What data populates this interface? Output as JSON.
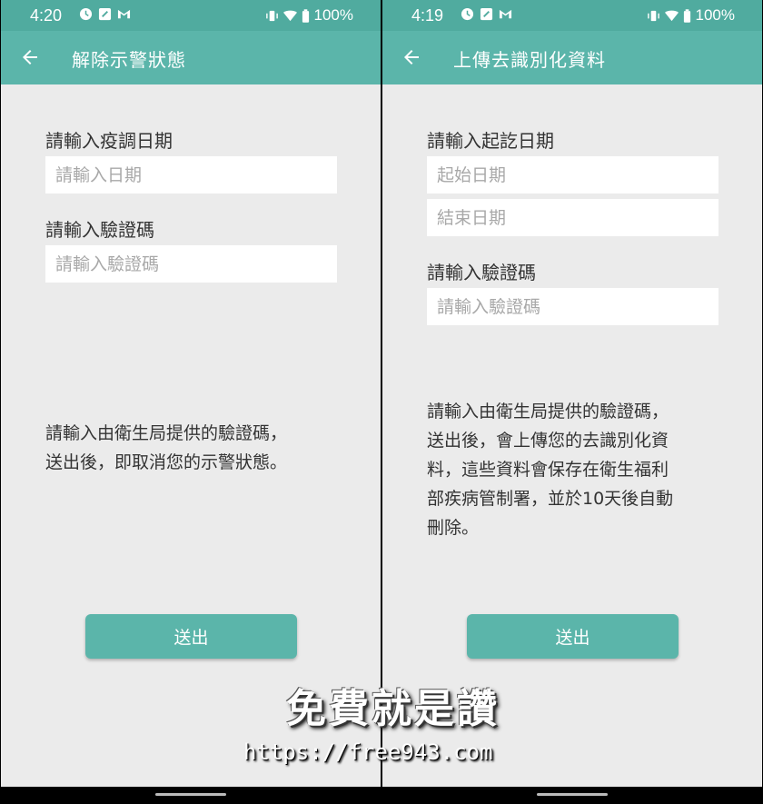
{
  "left": {
    "status": {
      "time": "4:20",
      "battery": "100%"
    },
    "appbar": {
      "title": "解除示警狀態"
    },
    "form": {
      "date_label": "請輸入疫調日期",
      "date_placeholder": "請輸入日期",
      "code_label": "請輸入驗證碼",
      "code_placeholder": "請輸入驗證碼"
    },
    "description": {
      "line1": "請輸入由衛生局提供的驗證碼，",
      "line2": "送出後，即取消您的示警狀態。"
    },
    "submit_label": "送出"
  },
  "right": {
    "status": {
      "time": "4:19",
      "battery": "100%"
    },
    "appbar": {
      "title": "上傳去識別化資料"
    },
    "form": {
      "date_label": "請輸入起訖日期",
      "start_placeholder": "起始日期",
      "end_placeholder": "結束日期",
      "code_label": "請輸入驗證碼",
      "code_placeholder": "請輸入驗證碼"
    },
    "description": {
      "line1": "請輸入由衛生局提供的驗證碼，",
      "line2": "送出後，會上傳您的去識別化資",
      "line3": "料，這些資料會保存在衛生福利",
      "line4": "部疾病管制署，並於10天後自動",
      "line5": "刪除。"
    },
    "submit_label": "送出"
  },
  "watermark": {
    "title": "免費就是讚",
    "url": "https://free943.com"
  },
  "icons": [
    "alarm-icon",
    "edit-icon",
    "gmail-icon",
    "vibrate-icon",
    "wifi-icon",
    "battery-icon",
    "back-arrow-icon"
  ],
  "colors": {
    "statusbar": "#50ab9f",
    "appbar": "#5bb5aa",
    "background": "#ebebeb",
    "button": "#5bb5aa"
  }
}
